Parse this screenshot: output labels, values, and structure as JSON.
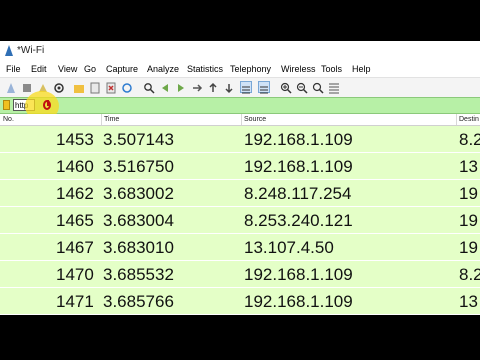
{
  "window": {
    "title": "*Wi-Fi"
  },
  "menu": [
    "File",
    "Edit",
    "View",
    "Go",
    "Capture",
    "Analyze",
    "Statistics",
    "Telephony",
    "Wireless",
    "Tools",
    "Help"
  ],
  "toolbar": {
    "icons": [
      "shark-fin-start-icon",
      "stop-icon",
      "restart-icon",
      "options-icon",
      "open-file-icon",
      "save-icon",
      "close-file-icon",
      "reload-icon",
      "find-icon",
      "go-back-icon",
      "go-forward-icon",
      "go-to-packet-icon",
      "first-packet-icon",
      "last-packet-icon",
      "autoscroll-icon",
      "colorize-icon",
      "zoom-in-icon",
      "zoom-out-icon",
      "normal-size-icon",
      "resize-columns-icon"
    ]
  },
  "filter": {
    "value": "http"
  },
  "packet_list": {
    "columns": [
      "No.",
      "Time",
      "Source",
      "Destin"
    ],
    "row_bg": "#e4ffc7",
    "rows": [
      {
        "no": "1453",
        "time": "3.507143",
        "source": "192.168.1.109",
        "dest": "8.2"
      },
      {
        "no": "1460",
        "time": "3.516750",
        "source": "192.168.1.109",
        "dest": "13"
      },
      {
        "no": "1462",
        "time": "3.683002",
        "source": "8.248.117.254",
        "dest": "19"
      },
      {
        "no": "1465",
        "time": "3.683004",
        "source": "8.253.240.121",
        "dest": "19"
      },
      {
        "no": "1467",
        "time": "3.683010",
        "source": "13.107.4.50",
        "dest": "19"
      },
      {
        "no": "1470",
        "time": "3.685532",
        "source": "192.168.1.109",
        "dest": "8.2"
      },
      {
        "no": "1471",
        "time": "3.685766",
        "source": "192.168.1.109",
        "dest": "13"
      }
    ]
  }
}
